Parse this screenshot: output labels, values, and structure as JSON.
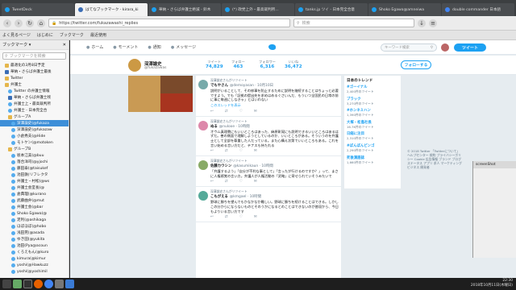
{
  "os_tabs": [
    {
      "label": "TweetDeck",
      "color": "#1da1f2"
    },
    {
      "label": "はてなブックマーク - kirara_ki",
      "color": "#3a6db5"
    },
    {
      "label": "華納・さらば弁護士絶滅 - 鈴木",
      "color": "#1da1f2"
    },
    {
      "label": "(*) 政党上外・最高裁判所... ",
      "color": "#1da1f2"
    },
    {
      "label": "tanks.jp ツイ - 日本完全合意",
      "color": "#1da1f2"
    },
    {
      "label": "Shoko Egawa@amneiwa",
      "color": "#1da1f2"
    },
    {
      "label": "double commander 日本語",
      "color": "#4285f4"
    }
  ],
  "window_title": "深澤諭史(@fukazawas0Iu4) | Twitterから投稿のタイムライン - Mozilla Firefox",
  "url": "https://twitter.com/fukazawashi_replies",
  "search_placeholder": "検索",
  "bookmarks_bar": [
    "よく見るページ",
    "はじめに",
    "ブックマーク",
    "最近使用"
  ],
  "sidebar": {
    "title": "ブックマーク ▾",
    "search_placeholder": "ブックマークを検索",
    "items": [
      {
        "label": "最適化の3月8日予定",
        "icon": "folder",
        "selected": false,
        "indent": 1
      },
      {
        "label": "華納・さらば弁護士最後",
        "icon": "hatena",
        "selected": false,
        "indent": 1
      },
      {
        "label": "Twitter",
        "icon": "folder",
        "selected": false,
        "indent": 1
      },
      {
        "label": "弁護士",
        "icon": "folder",
        "selected": false,
        "indent": 1
      },
      {
        "label": "Twitter の弁護士情報",
        "icon": "bird",
        "selected": false,
        "indent": 2
      },
      {
        "label": "華納・さらば弁護士残",
        "icon": "hatena",
        "selected": false,
        "indent": 2
      },
      {
        "label": "弁護士上・最高裁判所",
        "icon": "bird",
        "selected": false,
        "indent": 2
      },
      {
        "label": "弁護士 - 日本完全合",
        "icon": "bird",
        "selected": false,
        "indent": 2
      },
      {
        "label": "グループA",
        "icon": "folder",
        "selected": false,
        "indent": 2
      },
      {
        "label": "深澤諭史(@fukaza",
        "icon": "bird",
        "selected": true,
        "indent": 3
      },
      {
        "label": "深澤諭史(@fukazaw",
        "icon": "bird",
        "selected": false,
        "indent": 3
      },
      {
        "label": "小倉秀夫(@Hide",
        "icon": "bird",
        "selected": false,
        "indent": 3
      },
      {
        "label": "モトケン(@motoken",
        "icon": "bird",
        "selected": false,
        "indent": 3
      },
      {
        "label": "グループB",
        "icon": "folder",
        "selected": false,
        "indent": 2
      },
      {
        "label": "坂本江美(@buu",
        "icon": "bird",
        "selected": false,
        "indent": 3
      },
      {
        "label": "落合洋司(@yjochi",
        "icon": "bird",
        "selected": false,
        "indent": 3
      },
      {
        "label": "藤田泰(@taisukef",
        "icon": "bird",
        "selected": false,
        "indent": 3
      },
      {
        "label": "池田鉄(リフレクタ",
        "icon": "bird",
        "selected": false,
        "indent": 3
      },
      {
        "label": "弁護士・村松(@ws",
        "icon": "bird",
        "selected": false,
        "indent": 3
      },
      {
        "label": "弁護士会室長(@",
        "icon": "bird",
        "selected": false,
        "indent": 3
      },
      {
        "label": "倉典理(@kurano",
        "icon": "bird",
        "selected": false,
        "indent": 3
      },
      {
        "label": "武藤曲弁(@mut",
        "icon": "bird",
        "selected": false,
        "indent": 3
      },
      {
        "label": "弁護士会(@bar",
        "icon": "bird",
        "selected": false,
        "indent": 3
      },
      {
        "label": "Shoko Egawa(@",
        "icon": "bird",
        "selected": false,
        "indent": 3
      },
      {
        "label": "足利(@ashikaga",
        "icon": "bird",
        "selected": false,
        "indent": 3
      },
      {
        "label": "ほぼほぼ(@hobo",
        "icon": "bird",
        "selected": false,
        "indent": 3
      },
      {
        "label": "浅田晃(@asada",
        "icon": "bird",
        "selected": false,
        "indent": 3
      },
      {
        "label": "ゆき田(@yukita",
        "icon": "bird",
        "selected": false,
        "indent": 3
      },
      {
        "label": "池田(Pya@acoun",
        "icon": "bird",
        "selected": false,
        "indent": 3
      },
      {
        "label": "くろえもん(@kuro",
        "icon": "bird",
        "selected": false,
        "indent": 3
      },
      {
        "label": "kimura(@kimur",
        "icon": "bird",
        "selected": false,
        "indent": 3
      },
      {
        "label": "yoshi(@Hawkuzz",
        "icon": "bird",
        "selected": false,
        "indent": 3
      },
      {
        "label": "yoshi(@yoshimil",
        "icon": "bird",
        "selected": false,
        "indent": 3
      }
    ]
  },
  "twitter": {
    "nav": [
      "ホーム",
      "モーメント",
      "通知",
      "メッセージ"
    ],
    "search_placeholder": "キーワード検索",
    "tweet_button": "ツイート",
    "profile": {
      "name": "深澤諭史",
      "handle": "@fukazawas",
      "stats": [
        {
          "label": "ツイート",
          "value": "74,829"
        },
        {
          "label": "フォロー",
          "value": "463"
        },
        {
          "label": "フォロワー",
          "value": "6,316"
        },
        {
          "label": "いいね",
          "value": "36,472"
        }
      ],
      "follow_button": "フォローする"
    },
    "tweets": [
      {
        "context": "深澤諭史さんがリツイート",
        "name": "でもやさん",
        "handle": "@demoyasan · 10月10日",
        "text": "説明がいることして、その修事を防止するために説明を継続することはちょっと必要ですよう。でも「証拠の提出先を求めはめるぐさいんだ、もういつ全国民の日常の前に事に毎週にしなきゃ」とはいわない",
        "link": "このスレッドを表示",
        "avatar_color": "#7aa"
      },
      {
        "context": "深澤諭史さんがリツイート",
        "name": "ぬる",
        "handle": "@nulooe · 10時間",
        "text": "オウム真理教にもいいところはあった、麻原彰晃にも説明できるいいところはあるはずだ。善の側面で理解しようとしているのか、いいところがある。そういうのを弁護士として全部を尊重した人だっている。また心構え次第でいいところもある。これを言い始める言い方だと、テナスも持たれる",
        "link": "",
        "avatar_color": "#d8a"
      },
      {
        "context": "深澤諭史さんがリツイート",
        "name": "佐藤カウシン",
        "handle": "@kasumikaun · 10時間",
        "text": "「弁護するよう」「自分が不利な事として」「言ったが行けるのですか？」って、まさに人権感覚の言い方。弁護人が人権活動の「武略」に寄せられていそうみたいで",
        "link": "",
        "avatar_color": "#8a6"
      },
      {
        "context": "深澤諭史さんがリツイート",
        "name": "こもがえる",
        "handle": "@kmgael · 10時間",
        "text": "野球に勝ちを望んでもかなかなか難しい。野球に勝ちを続けることはできる。しかしこの分からにならないものとそのうかになるとのことはできないのが普段から、今日もよりいる言い方です",
        "link": "",
        "avatar_color": "#5a9"
      }
    ],
    "trends_head": "日本のトレンド",
    "trends": [
      {
        "name": "#ゴーイナル",
        "count": "2,400件のツイート"
      },
      {
        "name": "ブラック",
        "count": "3,270件のツイート"
      },
      {
        "name": "#ホンネミハン",
        "count": "1,390件のツイート"
      },
      {
        "name": "大塚・松島社長",
        "count": "16.7K件のツイート"
      },
      {
        "name": "日経に注目",
        "count": "2,310件のツイート"
      },
      {
        "name": "#ぼんぼんピンゴ",
        "count": "2,290件のツイート"
      },
      {
        "name": "死後漢語誌",
        "count": "1,660件のツイート"
      }
    ],
    "footer": "© 2018 Twitter 「Twitterについて」 ヘルプセンター 規約 プライバシーポリシー Cookie 広告情報 ブランド ブログ ステータス アプリ 求人 マーケティング ビジネス 開発者"
  },
  "side_window": {
    "title": "screenShot"
  },
  "clock": {
    "time": "22:30",
    "date": "2018年10月11日(木曜日)"
  }
}
